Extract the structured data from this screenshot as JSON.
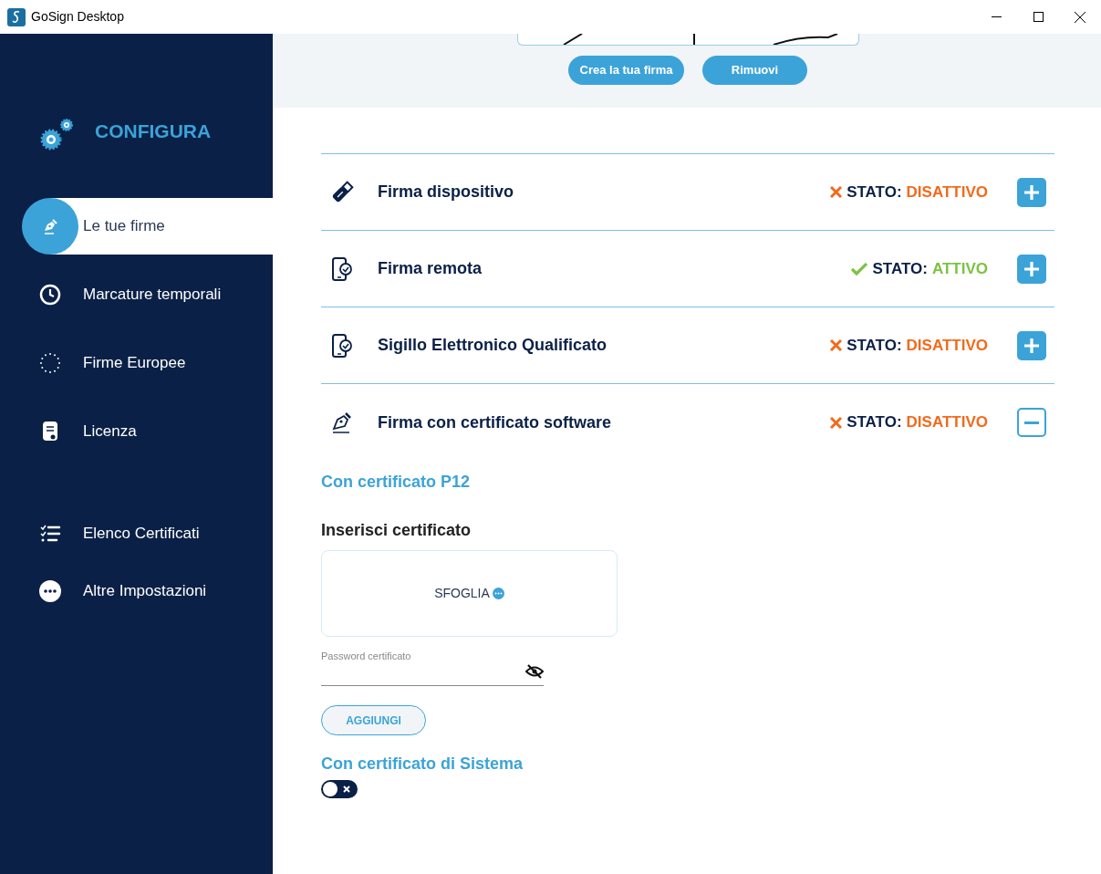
{
  "window": {
    "title": "GoSign Desktop"
  },
  "sidebar": {
    "heading": "CONFIGURA",
    "items": [
      {
        "label": "Le tue firme",
        "kind": "pen",
        "selected": true
      },
      {
        "label": "Marcature temporali",
        "kind": "clock",
        "selected": false
      },
      {
        "label": "Firme Europee",
        "kind": "stars",
        "selected": false
      },
      {
        "label": "Licenza",
        "kind": "license",
        "selected": false
      },
      {
        "label": "Elenco Certificati",
        "kind": "list",
        "selected": false
      },
      {
        "label": "Altre Impostazioni",
        "kind": "dots",
        "selected": false
      }
    ]
  },
  "signature_actions": [
    "Crea la tua firma",
    "Rimuovi"
  ],
  "sections": [
    {
      "title": "Firma dispositivo",
      "kind": "usb",
      "status_label": "STATO:",
      "status": "DISATTIVO",
      "active": false,
      "expanded": false
    },
    {
      "title": "Firma remota",
      "kind": "phone",
      "status_label": "STATO:",
      "status": "ATTIVO",
      "active": true,
      "expanded": false
    },
    {
      "title": "Sigillo Elettronico Qualificato",
      "kind": "phone",
      "status_label": "STATO:",
      "status": "DISATTIVO",
      "active": false,
      "expanded": false
    },
    {
      "title": "Firma con certificato software",
      "kind": "pen",
      "status_label": "STATO:",
      "status": "DISATTIVO",
      "active": false,
      "expanded": true
    }
  ],
  "p12": {
    "heading": "Con certificato P12",
    "label": "Inserisci certificato",
    "browse": "SFOGLIA",
    "password_placeholder": "Password certificato",
    "add_button": "AGGIUNGI"
  },
  "system": {
    "heading": "Con certificato di Sistema",
    "on": false
  }
}
